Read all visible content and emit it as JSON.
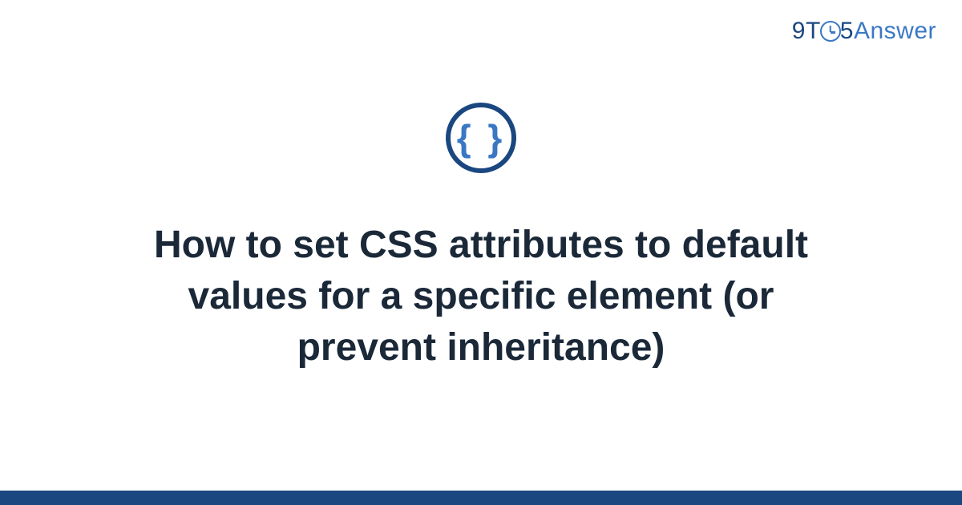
{
  "logo": {
    "part1": "9",
    "part2": "T",
    "part3": "5",
    "part4": "Answer"
  },
  "icon": {
    "symbol": "{ }",
    "name": "css-braces"
  },
  "title": "How to set CSS attributes to default values for a specific element (or prevent inheritance)",
  "colors": {
    "dark_blue": "#1a4780",
    "light_blue": "#3a78c4",
    "text": "#1a2838"
  }
}
